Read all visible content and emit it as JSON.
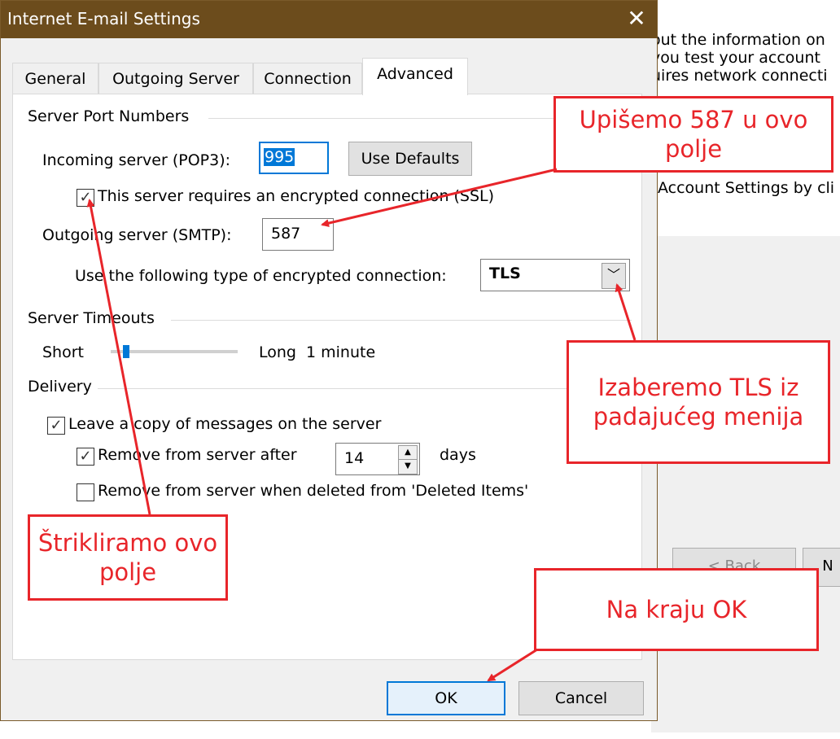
{
  "background": {
    "lines": [
      "out the information on",
      "you test your account",
      "uires network connecti",
      "Account Settings by cli"
    ],
    "back_label": "< Back",
    "next_label": "N"
  },
  "dialog": {
    "title": "Internet E-mail Settings",
    "close_glyph": "✕",
    "tabs": [
      "General",
      "Outgoing Server",
      "Connection",
      "Advanced"
    ],
    "active_tab": "Advanced",
    "server_ports": {
      "group_label": "Server Port Numbers",
      "incoming_label": "Incoming server (POP3):",
      "incoming_value": "995",
      "use_defaults_label": "Use Defaults",
      "ssl_checkbox_label": "This server requires an encrypted connection (SSL)",
      "ssl_checked": true,
      "outgoing_label": "Outgoing server (SMTP):",
      "outgoing_value": "587",
      "encryption_label": "Use the following type of encrypted connection:",
      "encryption_value": "TLS"
    },
    "timeouts": {
      "group_label": "Server Timeouts",
      "short_label": "Short",
      "long_label": "Long",
      "value_label": "1 minute",
      "slider_fraction": 0.05
    },
    "delivery": {
      "group_label": "Delivery",
      "leave_copy_label": "Leave a copy of messages on the server",
      "leave_copy_checked": true,
      "remove_after_label": "Remove from server after",
      "remove_after_checked": true,
      "remove_after_days": "14",
      "days_label": "days",
      "remove_deleted_label": "Remove from server when deleted from 'Deleted Items'",
      "remove_deleted_checked": false
    },
    "ok_label": "OK",
    "cancel_label": "Cancel"
  },
  "annotations": {
    "port_callout": "Upišemo 587 u ovo polje",
    "tls_callout": "Izaberemo TLS iz padajućeg menija",
    "ssl_callout": "Štrikliramo ovo polje",
    "ok_callout": "Na kraju OK"
  },
  "colors": {
    "title_bar": "#6c4c1c",
    "annotation_red": "#e8252a",
    "focus_blue": "#0078d7"
  }
}
